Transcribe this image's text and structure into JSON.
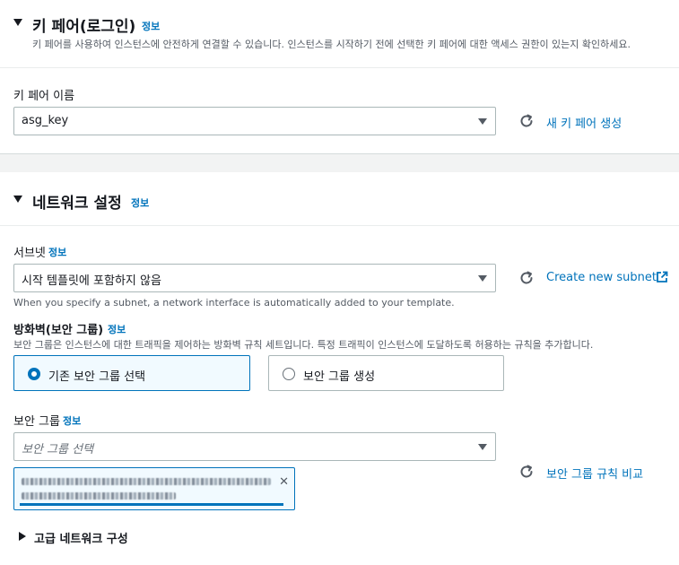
{
  "key_pair_section": {
    "title": "키 페어(로그인)",
    "info": "정보",
    "description": "키 페어를 사용하여 인스턴스에 안전하게 연결할 수 있습니다. 인스턴스를 시작하기 전에 선택한 키 페어에 대한 액세스 권한이 있는지 확인하세요.",
    "field_label": "키 페어 이름",
    "selected_value": "asg_key",
    "create_link": "새 키 페어 생성"
  },
  "network_section": {
    "title": "네트워크 설정",
    "info": "정보",
    "subnet": {
      "label": "서브넷",
      "info": "정보",
      "selected_value": "시작 템플릿에 포함하지 않음",
      "hint": "When you specify a subnet, a network interface is automatically added to your template.",
      "create_link": "Create new subnet"
    },
    "firewall": {
      "label": "방화벽(보안 그룹)",
      "info": "정보",
      "description": "보안 그룹은 인스턴스에 대한 트래픽을 제어하는 방화벽 규칙 세트입니다. 특정 트래픽이 인스턴스에 도달하도록 허용하는 규칙을 추가합니다.",
      "options": [
        {
          "label": "기존 보안 그룹 선택",
          "selected": true
        },
        {
          "label": "보안 그룹 생성",
          "selected": false
        }
      ]
    },
    "security_group": {
      "label": "보안 그룹",
      "info": "정보",
      "placeholder": "보안 그룹 선택",
      "compare_link": "보안 그룹 규칙 비교",
      "remove_symbol": "✕"
    },
    "advanced": {
      "label": "고급 네트워크 구성"
    }
  },
  "colors": {
    "link": "#0073bb",
    "text": "#16191f",
    "secondary_text": "#545b64",
    "border": "#aab7b8",
    "selected_bg": "#f1faff"
  },
  "icons": {
    "expand": "caret-down-icon",
    "collapse": "caret-right-icon",
    "refresh": "refresh-icon",
    "external": "external-link-icon"
  }
}
